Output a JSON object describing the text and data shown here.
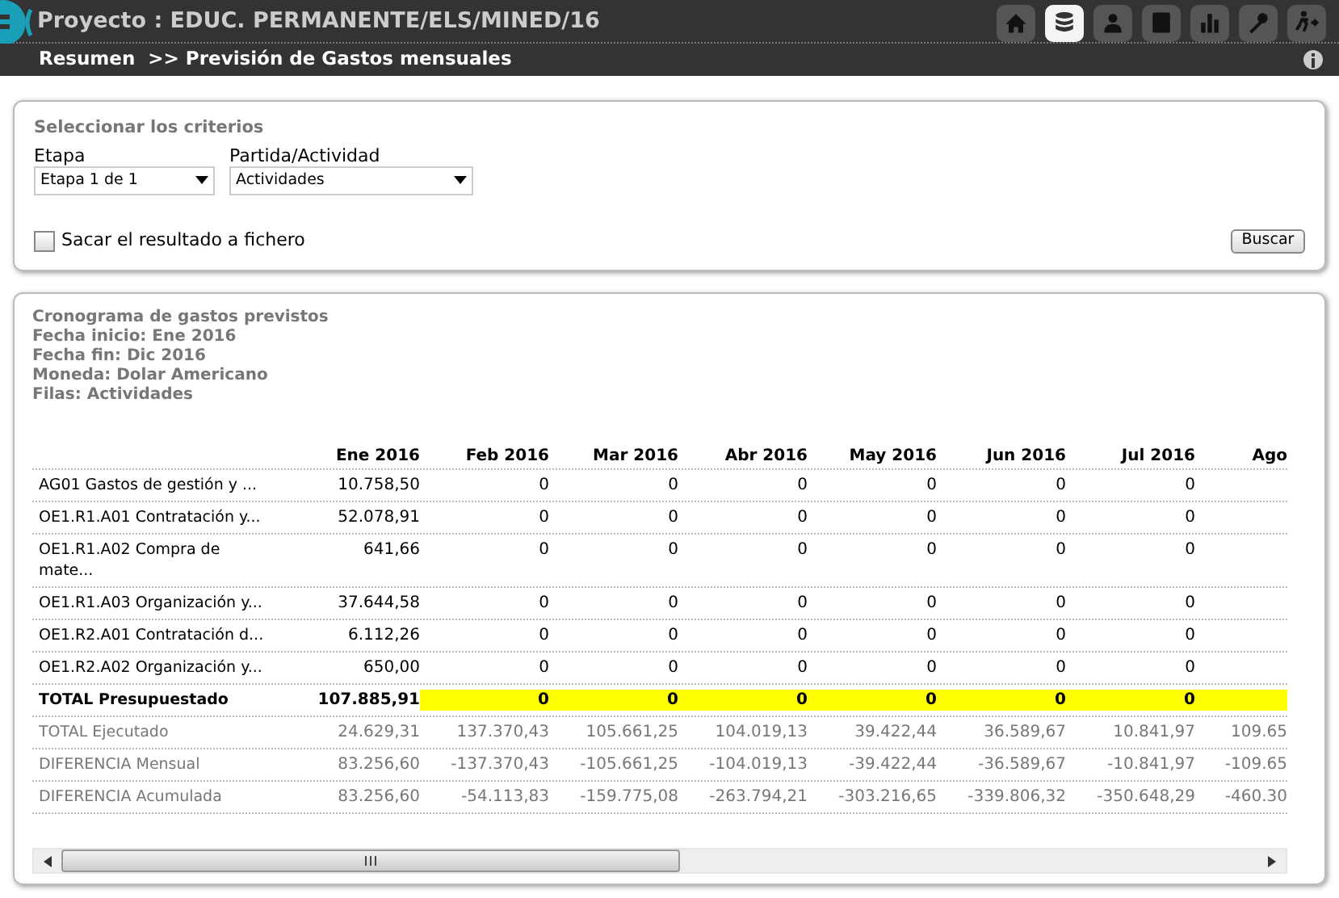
{
  "header": {
    "title": "Proyecto : EDUC. PERMANENTE/ELS/MINED/16",
    "breadcrumb": [
      "Resumen",
      ">> Previsión de Gastos mensuales"
    ],
    "nav": [
      {
        "kind": "home",
        "selected": false
      },
      {
        "kind": "database",
        "selected": true
      },
      {
        "kind": "person",
        "selected": false
      },
      {
        "kind": "book",
        "selected": false
      },
      {
        "kind": "chart",
        "selected": false
      },
      {
        "kind": "key",
        "selected": false
      },
      {
        "kind": "exit",
        "selected": false
      }
    ]
  },
  "criteria": {
    "title": "Seleccionar los criterios",
    "fields": [
      {
        "label": "Etapa",
        "value": "Etapa 1 de 1"
      },
      {
        "label": "Partida/Actividad",
        "value": "Actividades"
      }
    ],
    "export": {
      "label": "Sacar el resultado a fichero",
      "checked": false
    },
    "search_button": "Buscar"
  },
  "report": {
    "info": [
      "Cronograma de gastos previstos",
      "Fecha inicio: Ene 2016",
      "Fecha fin: Dic 2016",
      "Moneda: Dolar Americano",
      "Filas: Actividades"
    ],
    "columns": [
      "Ene 2016",
      "Feb 2016",
      "Mar 2016",
      "Abr 2016",
      "May 2016",
      "Jun 2016",
      "Jul 2016",
      "Ago"
    ],
    "rows": [
      {
        "kind": "activity",
        "label": "AG01 Gastos de gestión y ...",
        "values": [
          "10.758,50",
          "0",
          "0",
          "0",
          "0",
          "0",
          "0"
        ]
      },
      {
        "kind": "activity",
        "label": "OE1.R1.A01 Contratación y...",
        "values": [
          "52.078,91",
          "0",
          "0",
          "0",
          "0",
          "0",
          "0"
        ]
      },
      {
        "kind": "activity",
        "label": "OE1.R1.A02 Compra de\nmate...",
        "values": [
          "641,66",
          "0",
          "0",
          "0",
          "0",
          "0",
          "0"
        ]
      },
      {
        "kind": "activity",
        "label": "OE1.R1.A03 Organización y...",
        "values": [
          "37.644,58",
          "0",
          "0",
          "0",
          "0",
          "0",
          "0"
        ]
      },
      {
        "kind": "activity",
        "label": "OE1.R2.A01 Contratación d...",
        "values": [
          "6.112,26",
          "0",
          "0",
          "0",
          "0",
          "0",
          "0"
        ]
      },
      {
        "kind": "activity",
        "label": "OE1.R2.A02 Organización y...",
        "values": [
          "650,00",
          "0",
          "0",
          "0",
          "0",
          "0",
          "0"
        ]
      },
      {
        "kind": "total",
        "label": "TOTAL Presupuestado",
        "values": [
          "107.885,91",
          "0",
          "0",
          "0",
          "0",
          "0",
          "0"
        ],
        "highlighted": [
          false,
          true,
          true,
          true,
          true,
          true,
          true,
          true
        ]
      },
      {
        "kind": "summary",
        "label": "TOTAL Ejecutado",
        "values": [
          "24.629,31",
          "137.370,43",
          "105.661,25",
          "104.019,13",
          "39.422,44",
          "36.589,67",
          "10.841,97",
          "109.65"
        ]
      },
      {
        "kind": "summary",
        "label": "DIFERENCIA Mensual",
        "values": [
          "83.256,60",
          "-137.370,43",
          "-105.661,25",
          "-104.019,13",
          "-39.422,44",
          "-36.589,67",
          "-10.841,97",
          "-109.65"
        ]
      },
      {
        "kind": "summary",
        "label": "DIFERENCIA Acumulada",
        "values": [
          "83.256,60",
          "-54.113,83",
          "-159.775,08",
          "-263.794,21",
          "-303.216,65",
          "-339.806,32",
          "-350.648,29",
          "-460.30"
        ]
      }
    ]
  }
}
